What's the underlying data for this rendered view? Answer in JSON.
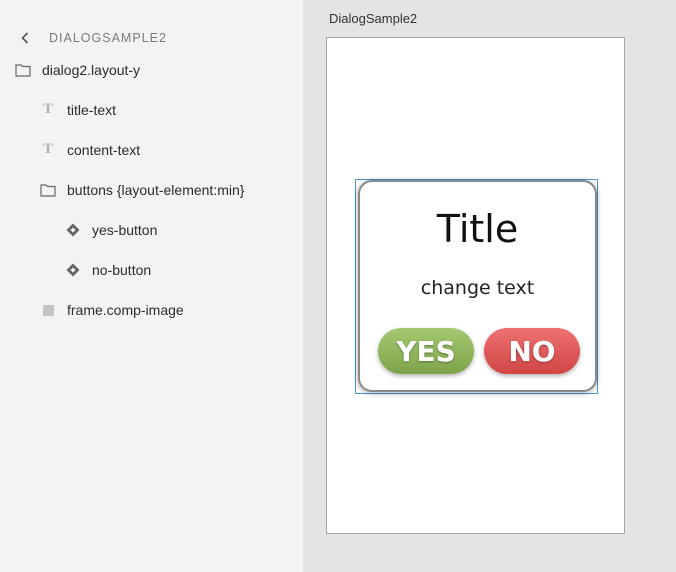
{
  "layers_panel": {
    "document_title": "DIALOGSAMPLE2",
    "items": [
      {
        "label": "dialog2.layout-y",
        "icon": "folder-icon"
      },
      {
        "label": "title-text",
        "icon": "text-icon"
      },
      {
        "label": "content-text",
        "icon": "text-icon"
      },
      {
        "label": "buttons {layout-element:min}",
        "icon": "folder-icon"
      },
      {
        "label": "yes-button",
        "icon": "component-icon"
      },
      {
        "label": "no-button",
        "icon": "component-icon"
      },
      {
        "label": "frame.comp-image",
        "icon": "rectangle-icon"
      }
    ]
  },
  "canvas": {
    "artboard_name": "DialogSample2",
    "dialog": {
      "title": "Title",
      "content": "change text",
      "yes_label": "YES",
      "no_label": "NO"
    }
  },
  "colors": {
    "selection": "#4a95d6",
    "yes_button": "#8db55a",
    "no_button": "#e05858"
  }
}
